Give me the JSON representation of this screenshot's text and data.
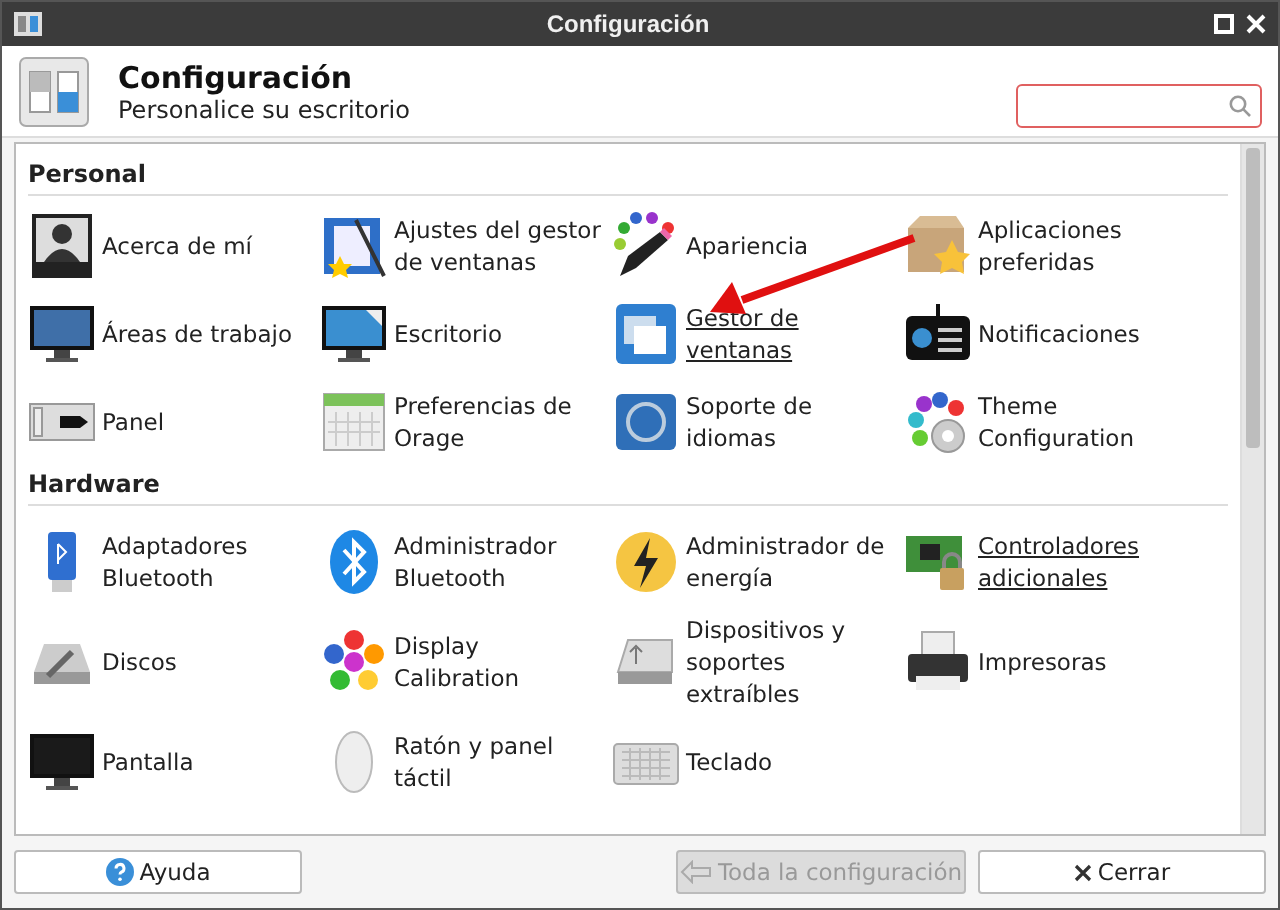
{
  "window": {
    "title": "Configuración"
  },
  "header": {
    "title": "Configuración",
    "subtitle": "Personalice su escritorio",
    "search": {
      "focused": true
    }
  },
  "sections": [
    {
      "title": "Personal",
      "items": [
        {
          "label": "Acerca de mí",
          "hovered": false
        },
        {
          "label": "Ajustes del gestor\nde ventanas",
          "hovered": false
        },
        {
          "label": "Apariencia",
          "hovered": false
        },
        {
          "label": "Aplicaciones\npreferidas",
          "hovered": false
        },
        {
          "label": "Áreas de trabajo",
          "hovered": false
        },
        {
          "label": "Escritorio",
          "hovered": false
        },
        {
          "label": "Gestor de\nventanas",
          "hovered": true
        },
        {
          "label": "Notificaciones",
          "hovered": false
        },
        {
          "label": "Panel",
          "hovered": false
        },
        {
          "label": "Preferencias de\nOrage",
          "hovered": false
        },
        {
          "label": "Soporte de\nidiomas",
          "hovered": false
        },
        {
          "label": "Theme\nConfiguration",
          "hovered": false
        }
      ]
    },
    {
      "title": "Hardware",
      "items": [
        {
          "label": "Adaptadores\nBluetooth",
          "hovered": false
        },
        {
          "label": "Administrador\nBluetooth",
          "hovered": false
        },
        {
          "label": "Administrador de\nenergía",
          "hovered": false
        },
        {
          "label": "Controladores\nadicionales",
          "hovered": true
        },
        {
          "label": "Discos",
          "hovered": false
        },
        {
          "label": "Display\nCalibration",
          "hovered": false
        },
        {
          "label": "Dispositivos y\nsoportes\nextraíbles",
          "hovered": false
        },
        {
          "label": "Impresoras",
          "hovered": false
        },
        {
          "label": "Pantalla",
          "hovered": false
        },
        {
          "label": "Ratón y panel\ntáctil",
          "hovered": false
        },
        {
          "label": "Teclado",
          "hovered": false
        }
      ]
    }
  ],
  "buttons": [
    {
      "label": "Ayuda",
      "kind": "help",
      "disabled": false
    },
    {
      "label": "Toda la configuración",
      "kind": "back",
      "disabled": true
    },
    {
      "label": "Cerrar",
      "kind": "close",
      "disabled": false
    }
  ]
}
